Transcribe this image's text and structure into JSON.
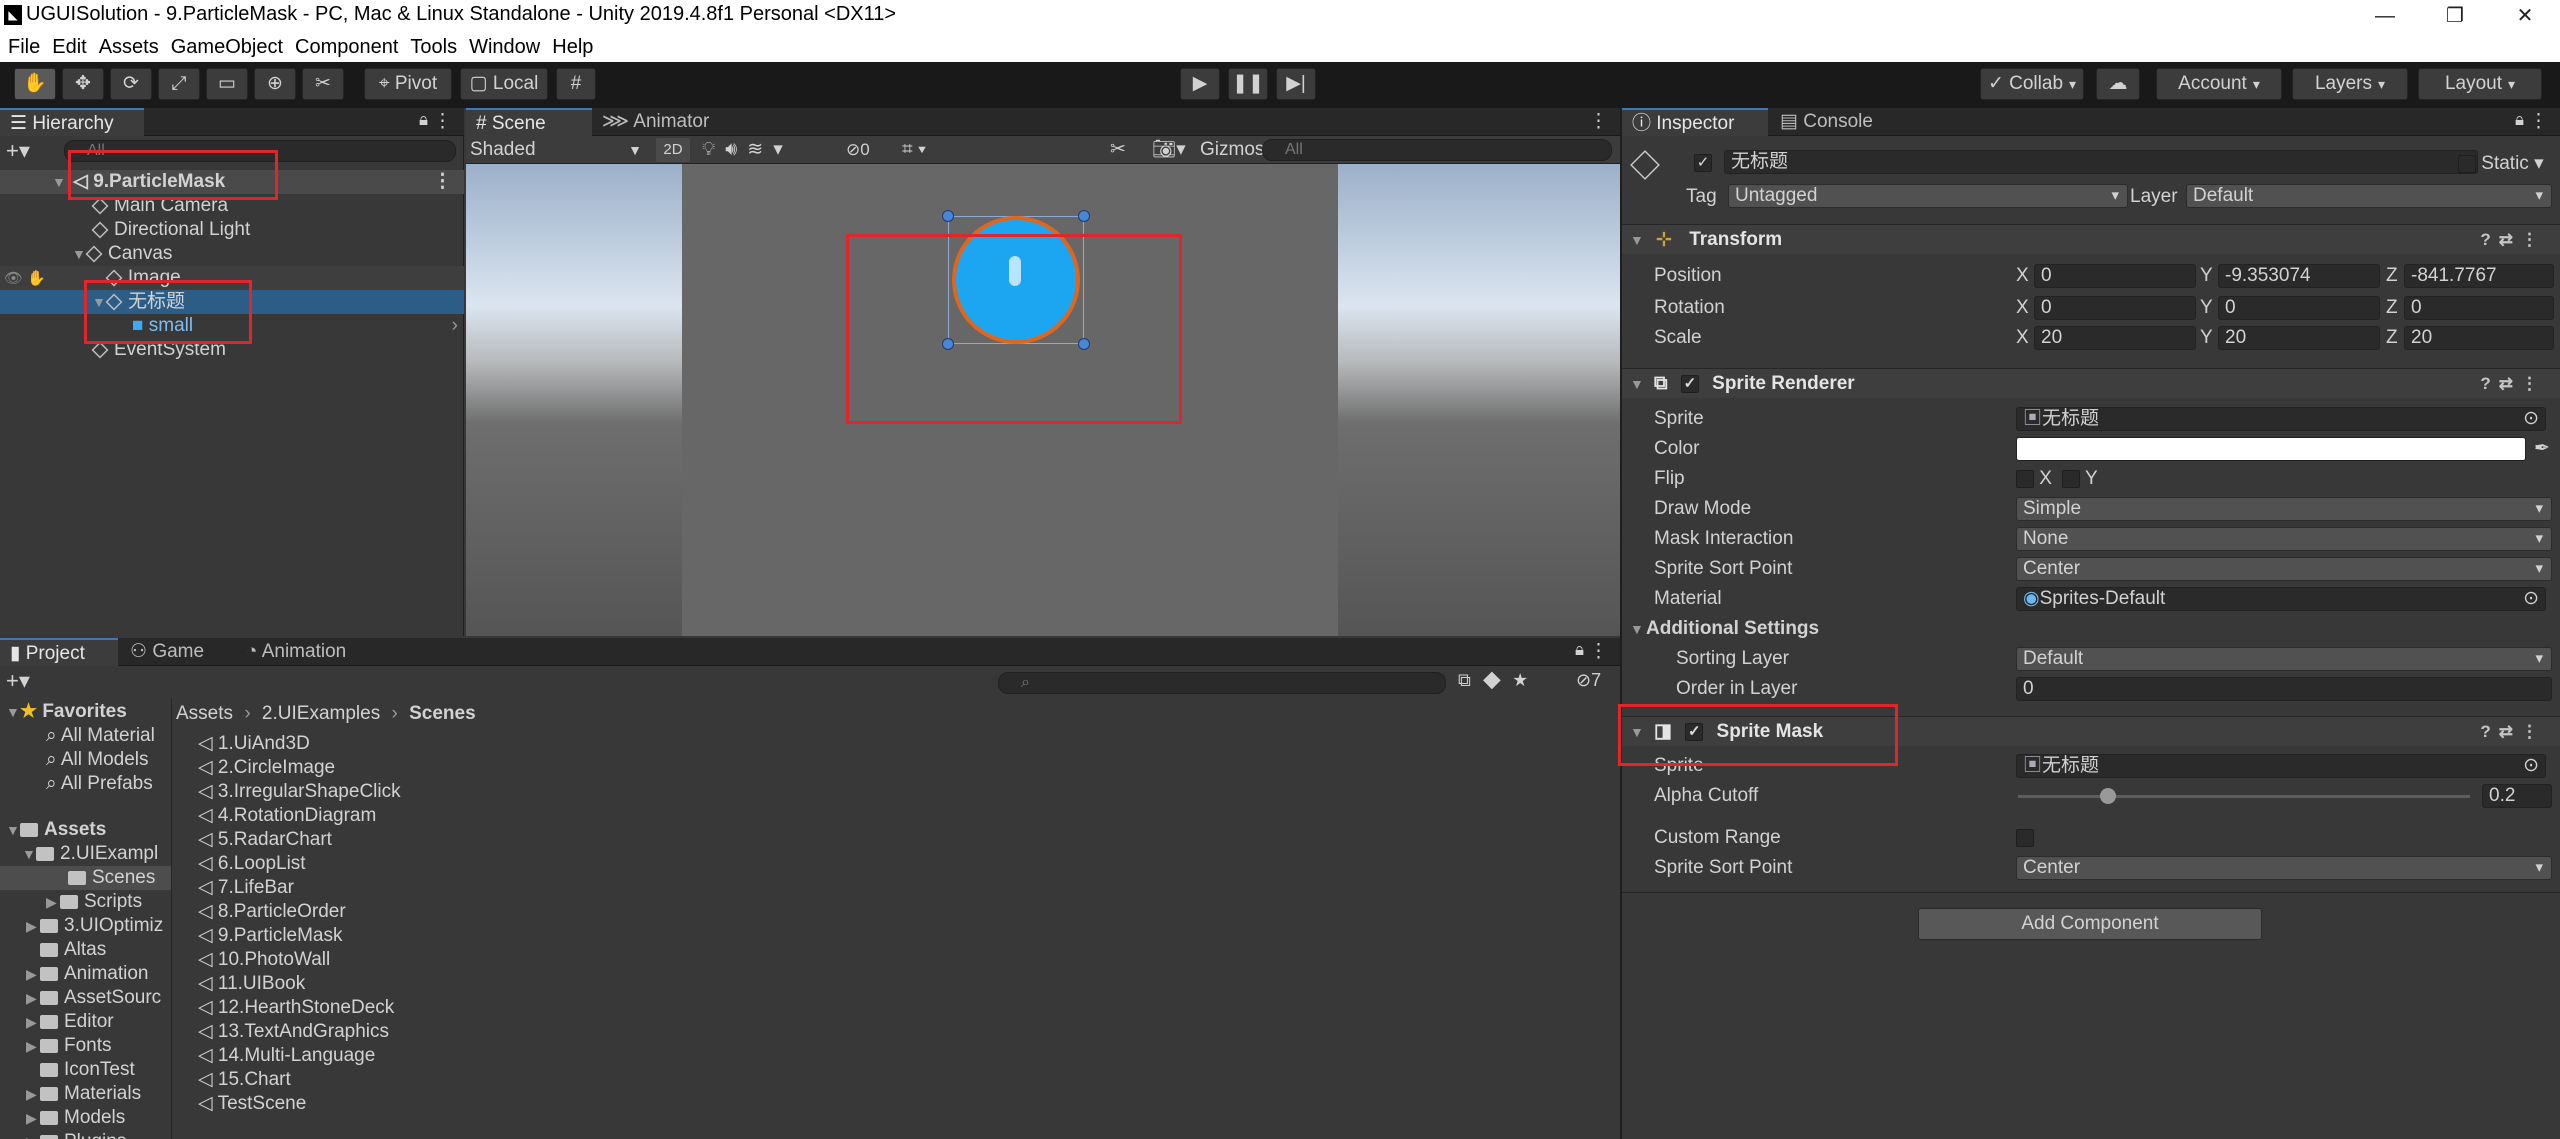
{
  "window": {
    "title": "UGUISolution - 9.ParticleMask - PC, Mac & Linux Standalone - Unity 2019.4.8f1 Personal <DX11>",
    "minimize": "—",
    "maximize": "❐",
    "close": "✕"
  },
  "menu": [
    "File",
    "Edit",
    "Assets",
    "GameObject",
    "Component",
    "Tools",
    "Window",
    "Help"
  ],
  "toolbar": {
    "pivot": "Pivot",
    "local": "Local",
    "collab": "Collab",
    "account": "Account",
    "layers": "Layers",
    "layout": "Layout"
  },
  "hierarchy": {
    "tab": "Hierarchy",
    "search_placeholder": "All",
    "items": [
      {
        "label": "9.ParticleMask"
      },
      {
        "label": "Main Camera"
      },
      {
        "label": "Directional Light"
      },
      {
        "label": "Canvas"
      },
      {
        "label": "Image"
      },
      {
        "label": "无标题"
      },
      {
        "label": "small"
      },
      {
        "label": "EventSystem"
      }
    ]
  },
  "scene": {
    "tabs": [
      "Scene",
      "Animator"
    ],
    "shading": "Shaded",
    "mode_2d": "2D",
    "hidden_count": "0",
    "gizmos": "Gizmos",
    "search_placeholder": "All"
  },
  "project": {
    "tabs": [
      "Project",
      "Game",
      "Animation"
    ],
    "hidden_count": "7",
    "favorites": {
      "label": "Favorites",
      "items": [
        "All Material",
        "All Models",
        "All Prefabs"
      ]
    },
    "assets": {
      "label": "Assets",
      "items": [
        "2.UIExampl",
        "Scenes",
        "Scripts",
        "3.UIOptimiz",
        "Altas",
        "Animation",
        "AssetSourc",
        "Editor",
        "Fonts",
        "IconTest",
        "Materials",
        "Models",
        "Plugins"
      ]
    },
    "breadcrumb": [
      "Assets",
      "2.UIExamples",
      "Scenes"
    ],
    "files": [
      "1.UiAnd3D",
      "2.CircleImage",
      "3.IrregularShapeClick",
      "4.RotationDiagram",
      "5.RadarChart",
      "6.LoopList",
      "7.LifeBar",
      "8.ParticleOrder",
      "9.ParticleMask",
      "10.PhotoWall",
      "11.UIBook",
      "12.HearthStoneDeck",
      "13.TextAndGraphics",
      "14.Multi-Language",
      "15.Chart",
      "TestScene"
    ]
  },
  "inspector": {
    "tabs": [
      "Inspector",
      "Console"
    ],
    "object_name": "无标题",
    "static": "Static",
    "tag_label": "Tag",
    "tag_value": "Untagged",
    "layer_label": "Layer",
    "layer_value": "Default",
    "transform": {
      "title": "Transform",
      "position": {
        "label": "Position",
        "x": "0",
        "y": "-9.353074",
        "z": "-841.7767"
      },
      "rotation": {
        "label": "Rotation",
        "x": "0",
        "y": "0",
        "z": "0"
      },
      "scale": {
        "label": "Scale",
        "x": "20",
        "y": "20",
        "z": "20"
      }
    },
    "sprite_renderer": {
      "title": "Sprite Renderer",
      "sprite_label": "Sprite",
      "sprite_value": "无标题",
      "color_label": "Color",
      "color_value": "#ffffff",
      "flip_label": "Flip",
      "flip_x": "X",
      "flip_y": "Y",
      "draw_mode_label": "Draw Mode",
      "draw_mode_value": "Simple",
      "mask_interaction_label": "Mask Interaction",
      "mask_interaction_value": "None",
      "sort_point_label": "Sprite Sort Point",
      "sort_point_value": "Center",
      "material_label": "Material",
      "material_value": "Sprites-Default",
      "additional_label": "Additional Settings",
      "sorting_layer_label": "Sorting Layer",
      "sorting_layer_value": "Default",
      "order_label": "Order in Layer",
      "order_value": "0"
    },
    "sprite_mask": {
      "title": "Sprite Mask",
      "sprite_label": "Sprite",
      "sprite_value": "无标题",
      "alpha_label": "Alpha Cutoff",
      "alpha_value": "0.2",
      "alpha_fraction": 0.2,
      "custom_range_label": "Custom Range",
      "sort_point_label": "Sprite Sort Point",
      "sort_point_value": "Center"
    },
    "add_component": "Add Component"
  },
  "colors": {
    "accent": "#3a79bb",
    "selection": "#2c5d87",
    "highlight_box": "#e0262b",
    "circle_fill": "#1ca6f2",
    "circle_ring": "#e0661e"
  }
}
